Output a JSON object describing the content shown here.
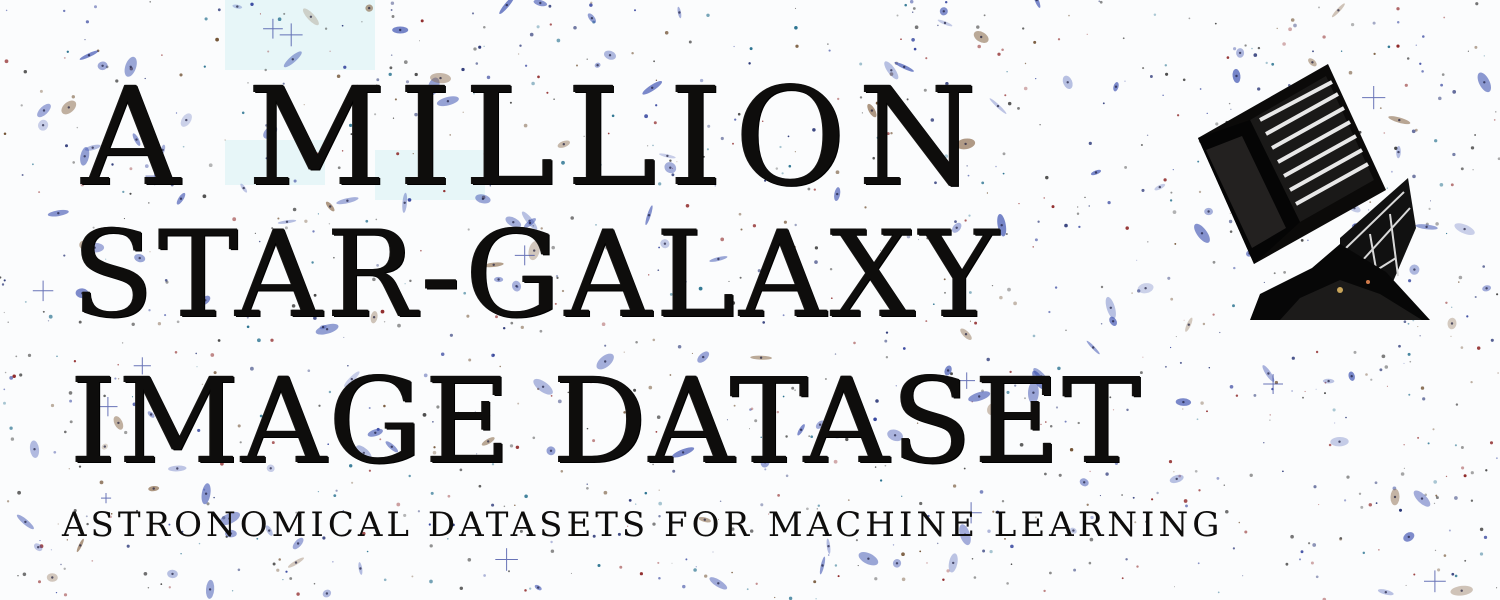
{
  "banner": {
    "title_lines": [
      "A MILLION",
      "STAR-GALAXY",
      "IMAGE DATASET"
    ],
    "subtitle": "ASTRONOMICAL DATASETS FOR MACHINE LEARNING"
  },
  "colors": {
    "background": "#fbfcfd",
    "text": "#0e0d0c",
    "galaxy_blue": "#3a4fb0",
    "galaxy_brown": "#8a6a4a",
    "accent_cyan": "#5ecfd8"
  },
  "icons": {
    "telescope": "telescope-icon"
  }
}
